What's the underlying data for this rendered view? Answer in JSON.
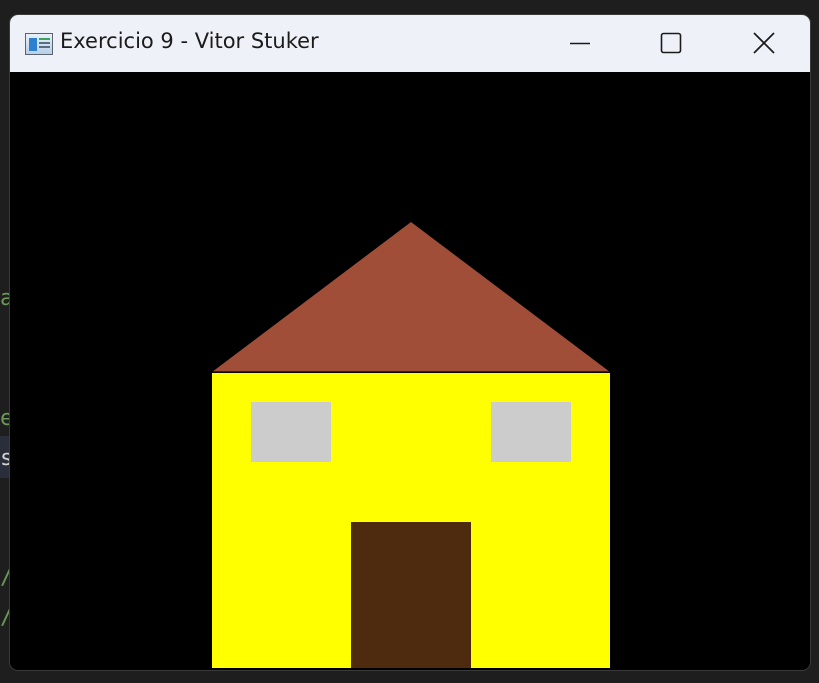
{
  "window": {
    "title": "Exercicio 9 - Vitor Stuker",
    "icon": "app-window-icon"
  },
  "caption_buttons": {
    "minimize": "minimize-icon",
    "maximize": "maximize-icon",
    "close": "close-icon"
  },
  "background_editor": {
    "glyphs": [
      "a",
      "e",
      "s",
      "/",
      "/"
    ]
  },
  "scene": {
    "background_color": "#000000",
    "roof_color": "#a04e37",
    "wall_color": "#ffff00",
    "window_color": "#cccccc",
    "door_color": "#4e2a0f"
  }
}
